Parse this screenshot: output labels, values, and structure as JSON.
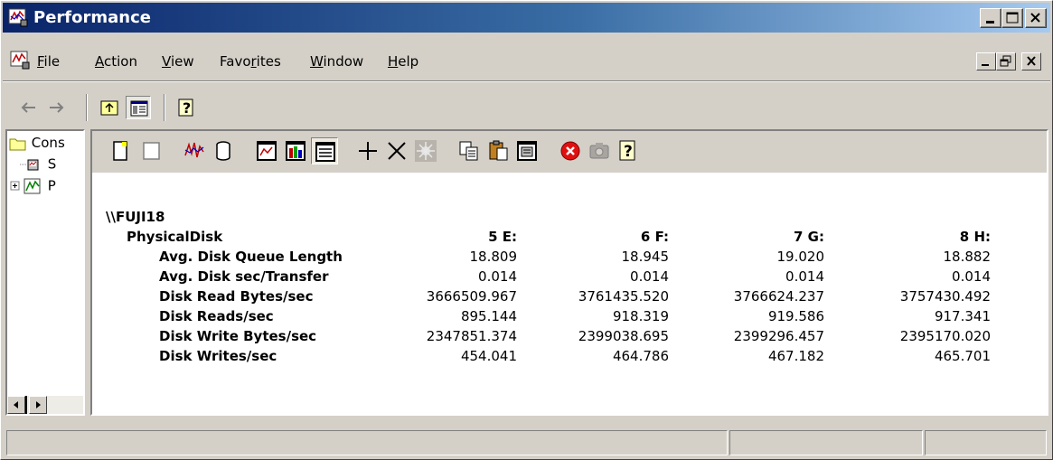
{
  "window": {
    "title": "Performance"
  },
  "menu": {
    "items": [
      {
        "label": "File",
        "u": "F",
        "rest": "ile"
      },
      {
        "label": "Action",
        "u": "A",
        "rest": "ction"
      },
      {
        "label": "View",
        "u": "V",
        "rest": "iew"
      },
      {
        "label": "Favorites",
        "pre": "Favo",
        "u": "r",
        "rest": "ites"
      },
      {
        "label": "Window",
        "u": "W",
        "rest": "indow"
      },
      {
        "label": "Help",
        "u": "H",
        "rest": "elp"
      }
    ]
  },
  "tree": {
    "items": [
      {
        "label": "Cons",
        "icon": "folder-icon"
      },
      {
        "label": "S",
        "icon": "system-monitor-icon"
      },
      {
        "label": "P",
        "icon": "performance-logs-icon"
      }
    ]
  },
  "report": {
    "computer": "\\\\FUJI18",
    "object": "PhysicalDisk",
    "instances": [
      "5 E:",
      "6 F:",
      "7 G:",
      "8 H:"
    ],
    "counters": [
      {
        "name": "Avg. Disk Queue Length",
        "values": [
          "18.809",
          "18.945",
          "19.020",
          "18.882"
        ]
      },
      {
        "name": "Avg. Disk sec/Transfer",
        "values": [
          "0.014",
          "0.014",
          "0.014",
          "0.014"
        ]
      },
      {
        "name": "Disk Read Bytes/sec",
        "values": [
          "3666509.967",
          "3761435.520",
          "3766624.237",
          "3757430.492"
        ]
      },
      {
        "name": "Disk Reads/sec",
        "values": [
          "895.144",
          "918.319",
          "919.586",
          "917.341"
        ]
      },
      {
        "name": "Disk Write Bytes/sec",
        "values": [
          "2347851.374",
          "2399038.695",
          "2399296.457",
          "2395170.020"
        ]
      },
      {
        "name": "Disk Writes/sec",
        "values": [
          "454.041",
          "464.786",
          "467.182",
          "465.701"
        ]
      }
    ]
  },
  "colors": {
    "titlebar_start": "#0a246a",
    "titlebar_end": "#a6caf0",
    "face": "#d4d0c8"
  }
}
